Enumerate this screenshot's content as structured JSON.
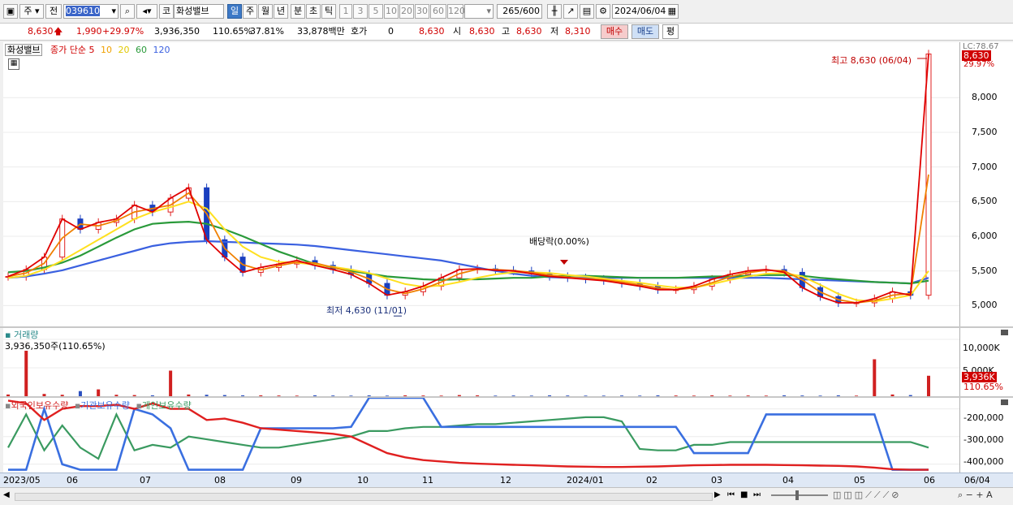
{
  "toolbar": {
    "market": "주",
    "prev_label": "전",
    "code": "039610",
    "name": "화성밸브",
    "periods": [
      "일",
      "주",
      "월",
      "년",
      "분",
      "초",
      "틱"
    ],
    "active_period": "일",
    "intervals": [
      "1",
      "3",
      "5",
      "10",
      "20",
      "30",
      "60",
      "120"
    ],
    "count": "265",
    "count_max": "/600",
    "date": "2024/06/04"
  },
  "quote": {
    "price": "8,630",
    "change": "1,990",
    "change_pct": "+29.97%",
    "volume": "3,936,350",
    "volume_ratio": "110.65%",
    "turnover": "37.81%",
    "amount": "33,878백만",
    "hoga_label": "호가",
    "hoga_value": "0",
    "ask": "8,630",
    "open_label": "시",
    "open": "8,630",
    "high_label": "고",
    "high": "8,630",
    "low_label": "저",
    "low": "8,310",
    "buy_label": "매수",
    "sell_label": "매도",
    "avg_label": "평"
  },
  "colors": {
    "up": "#d00000",
    "ma5": "#e00000",
    "ma10": "#f08000",
    "ma20": "#ffe020",
    "ma60": "#2a9a3a",
    "ma120": "#3a60e0",
    "foreign": "#e02020",
    "institution": "#3a6fe0",
    "individual": "#3a9a60"
  },
  "chart_data": [
    {
      "type": "candlestick",
      "legend": {
        "name": "화성밸브",
        "label": "종가 단순",
        "periods": [
          "5",
          "10",
          "20",
          "60",
          "120"
        ]
      },
      "x": [
        "2023/05",
        "06",
        "07",
        "08",
        "09",
        "10",
        "11",
        "12",
        "2024/01",
        "02",
        "03",
        "04",
        "05",
        "06",
        "06/04"
      ],
      "y_ticks": [
        "8,000",
        "7,500",
        "7,000",
        "6,500",
        "6,000",
        "5,500",
        "5,000"
      ],
      "ylim": [
        4700,
        8800
      ],
      "current_label": "8,630",
      "current_pct": "29.97%",
      "corner_label": "LC:78.67",
      "annotations": {
        "high": "최고 8,630 (06/04)",
        "low": "최저 4,630 (11/01)",
        "dividend": "배당락(0.00%)"
      },
      "close": [
        5420,
        5520,
        5700,
        6250,
        6100,
        6200,
        6250,
        6450,
        6350,
        6550,
        6700,
        5950,
        5700,
        5480,
        5550,
        5600,
        5650,
        5580,
        5520,
        5450,
        5320,
        5150,
        5200,
        5280,
        5400,
        5520,
        5530,
        5510,
        5500,
        5460,
        5420,
        5400,
        5380,
        5360,
        5320,
        5280,
        5230,
        5230,
        5280,
        5380,
        5450,
        5500,
        5520,
        5480,
        5260,
        5130,
        5040,
        5040,
        5100,
        5200,
        5150,
        8630
      ],
      "ma20": [
        5400,
        5430,
        5520,
        5650,
        5800,
        5950,
        6100,
        6250,
        6350,
        6420,
        6500,
        6400,
        6100,
        5850,
        5700,
        5630,
        5620,
        5590,
        5560,
        5520,
        5470,
        5390,
        5310,
        5270,
        5290,
        5340,
        5400,
        5450,
        5480,
        5480,
        5470,
        5440,
        5420,
        5390,
        5360,
        5330,
        5290,
        5260,
        5260,
        5310,
        5370,
        5420,
        5460,
        5470,
        5420,
        5300,
        5170,
        5080,
        5060,
        5100,
        5150,
        5500
      ],
      "ma60": [
        5480,
        5500,
        5550,
        5620,
        5720,
        5850,
        5980,
        6100,
        6180,
        6200,
        6210,
        6180,
        6100,
        6000,
        5890,
        5780,
        5690,
        5600,
        5550,
        5500,
        5460,
        5420,
        5400,
        5380,
        5370,
        5380,
        5380,
        5390,
        5400,
        5400,
        5420,
        5430,
        5430,
        5420,
        5410,
        5400,
        5400,
        5400,
        5410,
        5420,
        5420,
        5430,
        5440,
        5440,
        5430,
        5400,
        5380,
        5360,
        5340,
        5330,
        5320,
        5360
      ],
      "ma120": [
        5400,
        5420,
        5460,
        5510,
        5580,
        5650,
        5720,
        5790,
        5860,
        5900,
        5920,
        5930,
        5920,
        5910,
        5900,
        5890,
        5880,
        5860,
        5830,
        5800,
        5770,
        5740,
        5710,
        5680,
        5650,
        5600,
        5550,
        5500,
        5460,
        5430,
        5410,
        5400,
        5400,
        5400,
        5400,
        5400,
        5400,
        5400,
        5400,
        5400,
        5400,
        5400,
        5400,
        5390,
        5380,
        5370,
        5360,
        5350,
        5340,
        5330,
        5320,
        5400
      ]
    },
    {
      "type": "bar",
      "title": "거래량",
      "value_label": "3,936,350주(110.65%)",
      "y_ticks": [
        "10,000K",
        "5,000K"
      ],
      "current_label": "3,936K",
      "current_pct": "110.65%",
      "ylim": [
        0,
        12000
      ],
      "values": [
        300,
        8000,
        400,
        250,
        900,
        1200,
        250,
        200,
        150,
        4500,
        300,
        250,
        200,
        150,
        150,
        120,
        100,
        150,
        120,
        100,
        150,
        100,
        150,
        120,
        100,
        200,
        150,
        100,
        120,
        100,
        150,
        120,
        100,
        100,
        120,
        100,
        150,
        120,
        100,
        150,
        100,
        120,
        100,
        150,
        120,
        100,
        150,
        100,
        6500,
        300,
        200,
        3600
      ]
    },
    {
      "type": "line",
      "series_names": [
        "외국인보유수량",
        "기관보유수량",
        "개인보유수량"
      ],
      "y_ticks": [
        "-200,000",
        "-300,000",
        "-400,000"
      ],
      "ylim": [
        -430000,
        -160000
      ],
      "foreign": [
        -170000,
        -180000,
        -240000,
        -200000,
        -190000,
        -190000,
        -185000,
        -200000,
        -180000,
        -200000,
        -200000,
        -240000,
        -235000,
        -250000,
        -270000,
        -275000,
        -280000,
        -285000,
        -290000,
        -300000,
        -330000,
        -360000,
        -375000,
        -385000,
        -390000,
        -395000,
        -398000,
        -400000,
        -402000,
        -404000,
        -406000,
        -408000,
        -409000,
        -410000,
        -410000,
        -409000,
        -408000,
        -406000,
        -404000,
        -403000,
        -402000,
        -402000,
        -402000,
        -403000,
        -404000,
        -405000,
        -406000,
        -408000,
        -412000,
        -418000,
        -420000,
        -420000
      ],
      "institution": [
        -420000,
        -420000,
        -200000,
        -400000,
        -420000,
        -420000,
        -420000,
        -200000,
        -220000,
        -270000,
        -420000,
        -420000,
        -420000,
        -420000,
        -270000,
        -270000,
        -270000,
        -270000,
        -270000,
        -265000,
        -160000,
        -160000,
        -160000,
        -160000,
        -265000,
        -265000,
        -265000,
        -265000,
        -265000,
        -265000,
        -265000,
        -265000,
        -265000,
        -265000,
        -265000,
        -265000,
        -265000,
        -265000,
        -360000,
        -360000,
        -360000,
        -360000,
        -220000,
        -220000,
        -220000,
        -220000,
        -220000,
        -220000,
        -220000,
        -420000,
        -420000,
        -420000
      ],
      "individual": [
        -340000,
        -220000,
        -350000,
        -260000,
        -340000,
        -380000,
        -220000,
        -350000,
        -330000,
        -340000,
        -300000,
        -310000,
        -320000,
        -330000,
        -340000,
        -340000,
        -330000,
        -320000,
        -310000,
        -300000,
        -280000,
        -280000,
        -270000,
        -265000,
        -265000,
        -260000,
        -255000,
        -255000,
        -250000,
        -245000,
        -240000,
        -235000,
        -230000,
        -230000,
        -245000,
        -345000,
        -350000,
        -350000,
        -330000,
        -330000,
        -320000,
        -320000,
        -320000,
        -320000,
        -320000,
        -320000,
        -320000,
        -320000,
        -320000,
        -320000,
        -320000,
        -340000
      ]
    }
  ]
}
